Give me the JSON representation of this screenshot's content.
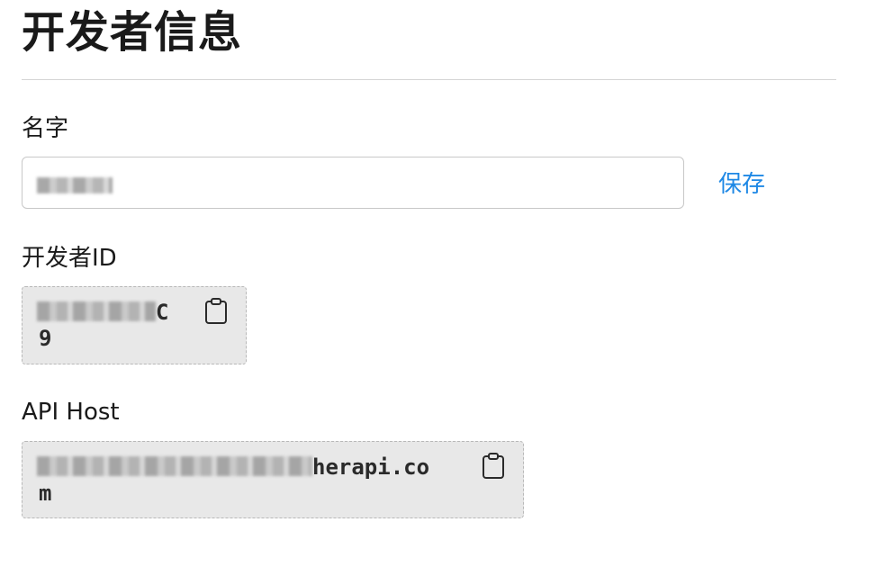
{
  "page": {
    "title": "开发者信息"
  },
  "name_section": {
    "label": "名字",
    "save_label": "保存"
  },
  "developer_id": {
    "label": "开发者ID",
    "line1_tail": "C",
    "line2": "9"
  },
  "api_host": {
    "label": "API Host",
    "line1_tail": "herapi.co",
    "line2": "m"
  },
  "colors": {
    "accent": "#1e88e5",
    "code_bg": "#e8e8e8"
  }
}
